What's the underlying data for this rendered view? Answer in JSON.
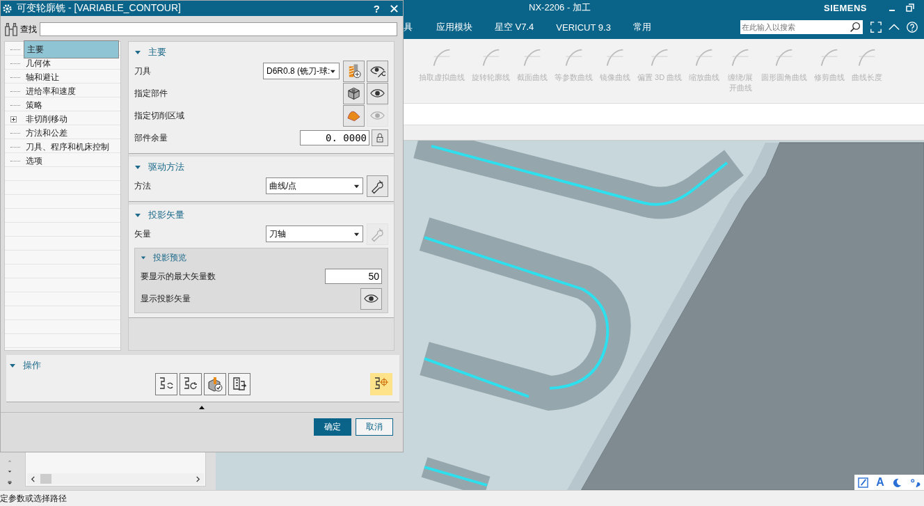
{
  "app": {
    "title": "NX-2206 - 加工",
    "brand": "SIEMENS"
  },
  "menu": [
    "具",
    "应用模块",
    "星空 V7.4",
    "VERICUT 9.3",
    "常用"
  ],
  "search": {
    "placeholder": "在此输入以搜索"
  },
  "ribbon": [
    {
      "label": "抽取虚拟曲线",
      "disabled": true
    },
    {
      "label": "旋转轮廓线",
      "disabled": true
    },
    {
      "label": "截面曲线",
      "disabled": true
    },
    {
      "label": "等参数曲线",
      "disabled": true
    },
    {
      "label": "镜像曲线",
      "disabled": true
    },
    {
      "label": "偏置 3D 曲线",
      "disabled": true
    },
    {
      "label": "缩放曲线",
      "disabled": true
    },
    {
      "label": "缠绕/展开曲线",
      "disabled": true
    },
    {
      "label": "圆形圆角曲线",
      "disabled": true
    },
    {
      "label": "修剪曲线",
      "disabled": true
    },
    {
      "label": "曲线长度",
      "disabled": true
    }
  ],
  "dialog": {
    "title": "可变轮廓铣 - [VARIABLE_CONTOUR]",
    "help": "?",
    "find": {
      "label": "查找"
    },
    "tree": [
      {
        "label": "主要",
        "selected": true
      },
      {
        "label": "几何体",
        "selected": false
      },
      {
        "label": "轴和避让",
        "selected": false
      },
      {
        "label": "进给率和速度",
        "selected": false
      },
      {
        "label": "策略",
        "selected": false
      },
      {
        "label": "非切削移动",
        "selected": false,
        "expanded": false
      },
      {
        "label": "方法和公差",
        "selected": false
      },
      {
        "label": "刀具、程序和机床控制",
        "selected": false
      },
      {
        "label": "选项",
        "selected": false
      }
    ],
    "sections": [
      {
        "title": "主要",
        "expanded": true,
        "rows": [
          {
            "kind": "select",
            "label": "刀具",
            "value": "D6R0.8 (铣刀-球:",
            "buttons": [
              {
                "disabled": false
              },
              {
                "disabled": false
              }
            ]
          },
          {
            "kind": "buttons",
            "label": "指定部件",
            "buttons": [
              {
                "disabled": false
              },
              {
                "disabled": false
              }
            ]
          },
          {
            "kind": "buttons",
            "label": "指定切削区域",
            "buttons": [
              {
                "disabled": false
              },
              {
                "disabled": true
              }
            ]
          },
          {
            "kind": "number",
            "label": "部件余量",
            "value": "0. 0000",
            "buttons": [
              {
                "disabled": false
              }
            ]
          }
        ]
      },
      {
        "title": "驱动方法",
        "expanded": true,
        "rows": [
          {
            "kind": "select",
            "label": "方法",
            "value": "曲线/点",
            "buttons": [
              {
                "disabled": false
              }
            ]
          }
        ]
      },
      {
        "title": "投影矢量",
        "expanded": true,
        "rows": [
          {
            "kind": "select",
            "label": "矢量",
            "value": "刀轴",
            "buttons": [
              {
                "disabled": true
              }
            ]
          }
        ],
        "subsection": {
          "title": "投影预览",
          "expanded": true,
          "rows": [
            {
              "kind": "number",
              "label": "要显示的最大矢量数",
              "value": "50"
            },
            {
              "kind": "buttons",
              "label": "显示投影矢量",
              "buttons": [
                {
                  "disabled": false
                }
              ]
            }
          ]
        }
      }
    ],
    "operations": {
      "title": "操作",
      "expanded": true,
      "actions": [
        {
          "highlighted": false
        },
        {
          "highlighted": false
        },
        {
          "highlighted": false
        },
        {
          "highlighted": false
        },
        {
          "highlighted": true
        }
      ]
    },
    "ok": "确定",
    "cancel": "取消"
  },
  "ime": {
    "label": "A"
  },
  "status": "定参数或选择路径"
}
